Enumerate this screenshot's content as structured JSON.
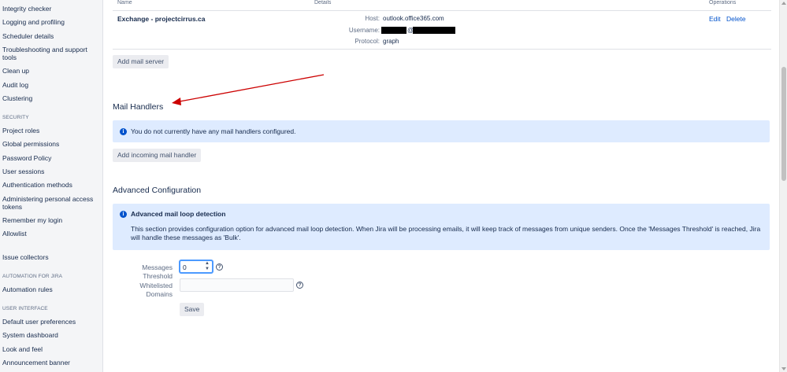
{
  "sidebar": {
    "items": [
      {
        "label": "Integrity checker"
      },
      {
        "label": "Logging and profiling"
      },
      {
        "label": "Scheduler details"
      },
      {
        "label": "Troubleshooting and support tools"
      },
      {
        "label": "Clean up"
      },
      {
        "label": "Audit log"
      },
      {
        "label": "Clustering"
      }
    ],
    "security_heading": "SECURITY",
    "security_items": [
      {
        "label": "Project roles"
      },
      {
        "label": "Global permissions"
      },
      {
        "label": "Password Policy"
      },
      {
        "label": "User sessions"
      },
      {
        "label": "Authentication methods"
      },
      {
        "label": "Administering personal access tokens"
      },
      {
        "label": "Remember my login"
      },
      {
        "label": "Allowlist"
      }
    ],
    "issue_collectors": "Issue collectors",
    "automation_heading": "AUTOMATION FOR JIRA",
    "automation_rules": "Automation rules",
    "ui_heading": "USER INTERFACE",
    "ui_items": [
      {
        "label": "Default user preferences"
      },
      {
        "label": "System dashboard"
      },
      {
        "label": "Look and feel"
      },
      {
        "label": "Announcement banner"
      }
    ]
  },
  "mail_servers": {
    "columns": {
      "name": "Name",
      "details": "Details",
      "operations": "Operations"
    },
    "server": {
      "name": "Exchange - projectcirrus.ca",
      "host_label": "Host:",
      "host_value": "outlook.office365.com",
      "username_label": "Username:",
      "username_at": "@",
      "protocol_label": "Protocol:",
      "protocol_value": "graph",
      "edit": "Edit",
      "delete": "Delete"
    },
    "add_button": "Add mail server"
  },
  "mail_handlers": {
    "title": "Mail Handlers",
    "info_message": "You do not currently have any mail handlers configured.",
    "add_button": "Add incoming mail handler"
  },
  "advanced": {
    "title": "Advanced Configuration",
    "loop_title": "Advanced mail loop detection",
    "loop_desc": "This section provides configuration option for advanced mail loop detection. When Jira will be processing emails, it will keep track of messages from unique senders. Once the 'Messages Threshold' is reached, Jira will handle these messages as 'Bulk'.",
    "threshold_label": "Messages Threshold",
    "threshold_value": "0",
    "domains_label": "Whitelisted Domains",
    "domains_value": "",
    "save_button": "Save"
  },
  "colors": {
    "arrow": "#cc0000",
    "link": "#0052cc",
    "info_bg": "#deebff"
  }
}
